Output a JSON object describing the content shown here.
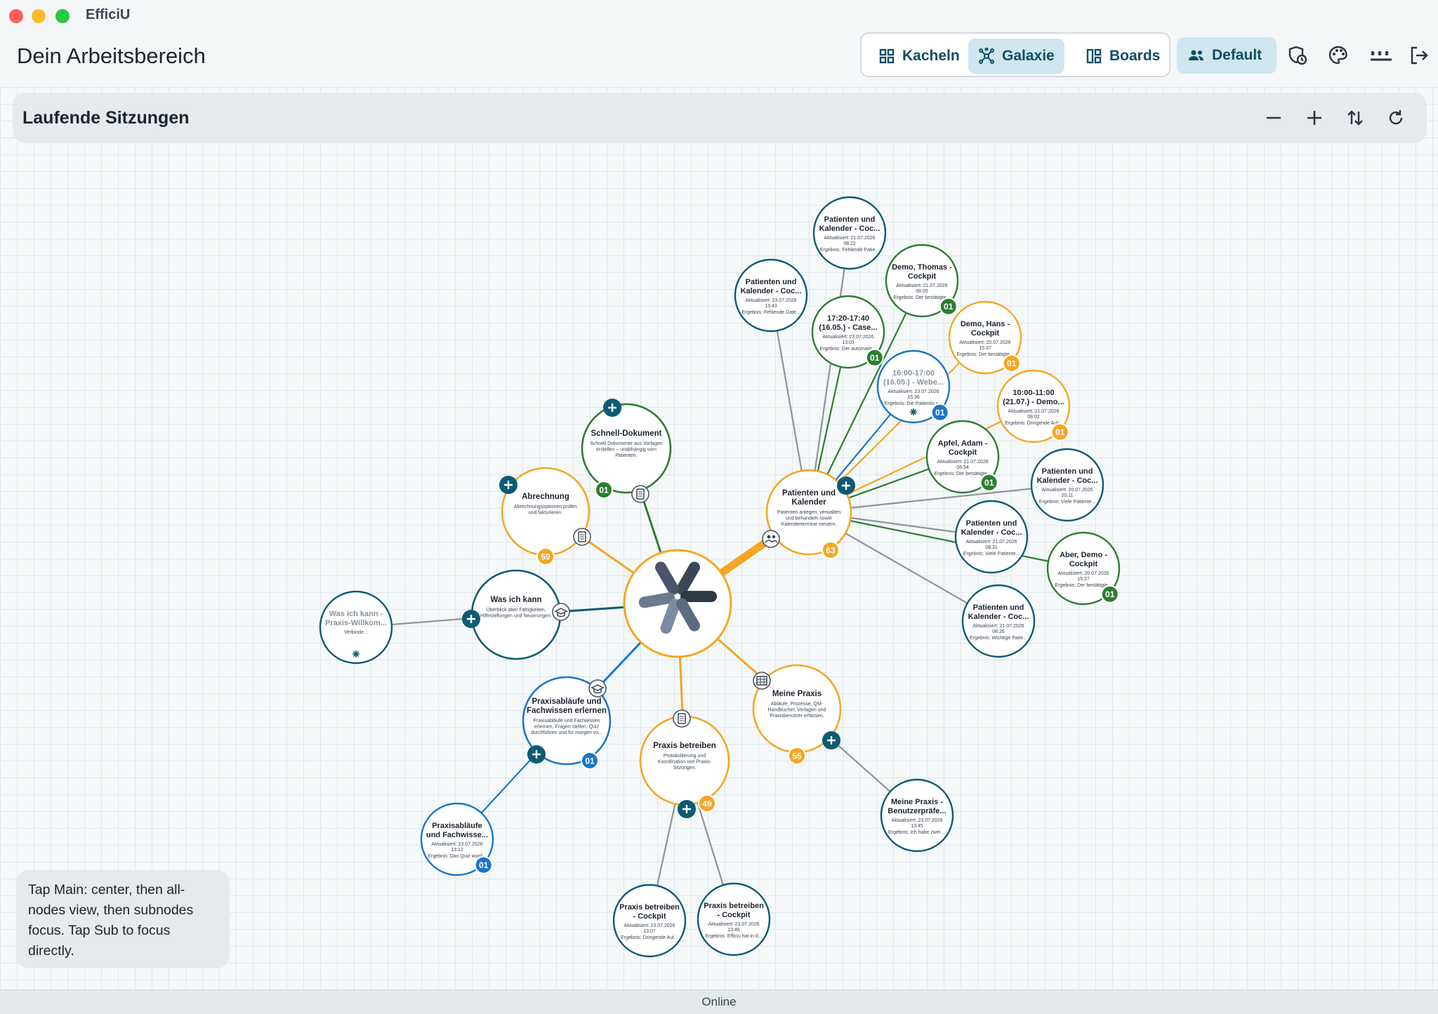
{
  "window": {
    "app_name": "EfficiU",
    "traffic_light_colors": [
      "#ff5f57",
      "#febc2e",
      "#28c840"
    ]
  },
  "header": {
    "title": "Dein Arbeitsbereich",
    "view_switch": [
      {
        "label": "Kacheln",
        "icon": "grid-icon",
        "active": false
      },
      {
        "label": "Galaxie",
        "icon": "galaxy-icon",
        "active": true
      },
      {
        "label": "Boards",
        "icon": "boards-icon",
        "active": false
      }
    ],
    "profile_label": "Default",
    "icons": [
      "shield-clock-icon",
      "palette-icon",
      "password-icon",
      "logout-icon"
    ]
  },
  "session_bar": {
    "title": "Laufende Sitzungen",
    "icons": [
      "zoom-out-icon",
      "zoom-in-icon",
      "sort-icon",
      "refresh-icon"
    ]
  },
  "colors": {
    "orange": "#f5a623",
    "green": "#2e7d32",
    "teal": "#0d5b73",
    "blue": "#1976c8",
    "gray_edge": "#8e9499"
  },
  "graph": {
    "main": {
      "name": "EfficiU",
      "icon": "efficiu-logo"
    },
    "categories": [
      {
        "id": "patienten",
        "title": "Patienten und Kalender",
        "desc": [
          "Patienten anlegen, verwalten",
          "und behandeln sowie",
          "Kalendertermine steuern."
        ],
        "count": "63",
        "color": "orange",
        "icon": "users-icon"
      },
      {
        "id": "abrechnung",
        "title": "Abrechnung",
        "desc": [
          "Abrechnungsoptionen prüfen",
          "und fakturieren."
        ],
        "count": "59",
        "color": "orange",
        "icon": "invoice-icon"
      },
      {
        "id": "schnell",
        "title": "Schnell-Dokument",
        "desc": [
          "Schnell Dokumente aus Vorlagen",
          "erstellen – unabhängig vom",
          "Patienten."
        ],
        "count": "01",
        "color": "green",
        "icon": "document-icon"
      },
      {
        "id": "wasichkann",
        "title": "Was ich kann",
        "desc": [
          "Überblick über Fähigkeiten,",
          "Hilfestellungen und Neuerungen."
        ],
        "count": "",
        "color": "teal",
        "icon": "graduation-cap-icon"
      },
      {
        "id": "praxisablaeufe",
        "title": "Praxisabläufe und Fachwissen erlernen",
        "desc": [
          "Praxisabläufe und Fachwissen",
          "erlernen, Fragen stellen, Quiz",
          "durchführen und für morgen vo..."
        ],
        "count": "01",
        "color": "blue",
        "icon": "graduation-cap-icon"
      },
      {
        "id": "praxisbetreiben",
        "title": "Praxis betreiben",
        "desc": [
          "Protokollierung und",
          "Koordination von Praxis-",
          "Sitzungen."
        ],
        "count": "49",
        "color": "orange",
        "icon": "clipboard-icon"
      },
      {
        "id": "meinepraxis",
        "title": "Meine Praxis",
        "desc": [
          "Abläufe, Prozesse, QM-",
          "Handbücher, Vorlagen und",
          "Praxisbenutzer erfassen."
        ],
        "count": "55",
        "color": "orange",
        "icon": "table-icon"
      }
    ],
    "sessions": [
      {
        "parent": "patienten",
        "title": [
          "Patienten und",
          "Kalender - Coc..."
        ],
        "updated": "Aktualisiert: 21.07.2026",
        "time": "08:22",
        "result": "Ergebnis: Fehlende Patie...",
        "color": "teal",
        "badge": ""
      },
      {
        "parent": "patienten",
        "title": [
          "Patienten und",
          "Kalender - Coc..."
        ],
        "updated": "Aktualisiert: 23.07.2026",
        "time": "13:43",
        "result": "Ergebnis: Fehlende Date...",
        "color": "teal",
        "badge": ""
      },
      {
        "parent": "patienten",
        "title": [
          "Demo, Thomas -",
          "Cockpit"
        ],
        "updated": "Aktualisiert: 21.07.2026",
        "time": "08:05",
        "result": "Ergebnis: Der bestätigte...",
        "color": "green",
        "badge": "01"
      },
      {
        "parent": "patienten",
        "title": [
          "17:20-17:40",
          "(16.05.) - Case..."
        ],
        "updated": "Aktualisiert: 23.07.2026",
        "time": "13:03",
        "result": "Ergebnis: Der automatis...",
        "color": "green",
        "badge": "01"
      },
      {
        "parent": "patienten",
        "title": [
          "Demo, Hans -",
          "Cockpit"
        ],
        "updated": "Aktualisiert: 20.07.2026",
        "time": "15:37",
        "result": "Ergebnis: Der bestätigte...",
        "color": "orange",
        "badge": "01"
      },
      {
        "parent": "patienten",
        "title": [
          "16:00-17:00",
          "(16.05.) - Webe..."
        ],
        "updated": "Aktualisiert: 23.07.2026",
        "time": "15:36",
        "result": "Ergebnis: Die Patientin s...",
        "color": "blue",
        "badge": "01",
        "faded": true
      },
      {
        "parent": "patienten",
        "title": [
          "10:00-11:00",
          "(21.07.) - Demo..."
        ],
        "updated": "Aktualisiert: 21.07.2026",
        "time": "08:02",
        "result": "Ergebnis: Dringende Auf...",
        "color": "orange",
        "badge": "01"
      },
      {
        "parent": "patienten",
        "title": [
          "Apfel, Adam -",
          "Cockpit"
        ],
        "updated": "Aktualisiert: 21.07.2026",
        "time": "08:54",
        "result": "Ergebnis: Der bestätigte...",
        "color": "green",
        "badge": "01"
      },
      {
        "parent": "patienten",
        "title": [
          "Patienten und",
          "Kalender - Coc..."
        ],
        "updated": "Aktualisiert: 20.07.2026",
        "time": "20:11",
        "result": "Ergebnis: Viele Patiente...",
        "color": "teal",
        "badge": ""
      },
      {
        "parent": "patienten",
        "title": [
          "Patienten und",
          "Kalender - Coc..."
        ],
        "updated": "Aktualisiert: 21.07.2026",
        "time": "08:31",
        "result": "Ergebnis: Viele Patiente...",
        "color": "teal",
        "badge": ""
      },
      {
        "parent": "patienten",
        "title": [
          "Aber, Demo -",
          "Cockpit"
        ],
        "updated": "Aktualisiert: 20.07.2026",
        "time": "15:27",
        "result": "Ergebnis: Der bestätigte...",
        "color": "green",
        "badge": "01"
      },
      {
        "parent": "patienten",
        "title": [
          "Patienten und",
          "Kalender - Coc..."
        ],
        "updated": "Aktualisiert: 21.07.2026",
        "time": "08:26",
        "result": "Ergebnis: Wichtige Patie...",
        "color": "teal",
        "badge": ""
      },
      {
        "parent": "wasichkann",
        "title": [
          "Was ich kann -",
          "Praxis-Willkom..."
        ],
        "updated": "Verbinde...",
        "time": "",
        "result": "",
        "color": "teal",
        "badge": "",
        "faded": true
      },
      {
        "parent": "praxisablaeufe",
        "title": [
          "Praxisabläufe",
          "und Fachwisse..."
        ],
        "updated": "Aktualisiert: 23.07.2026",
        "time": "13:12",
        "result": "Ergebnis: Das Quiz wurd...",
        "color": "blue",
        "badge": "01"
      },
      {
        "parent": "praxisbetreiben",
        "title": [
          "Praxis betreiben",
          "- Cockpit"
        ],
        "updated": "Aktualisiert: 23.07.2026",
        "time": "13:07",
        "result": "Ergebnis: Dringende Auf...",
        "color": "teal",
        "badge": ""
      },
      {
        "parent": "praxisbetreiben",
        "title": [
          "Praxis betreiben",
          "- Cockpit"
        ],
        "updated": "Aktualisiert: 23.07.2026",
        "time": "13:46",
        "result": "Ergebnis: Efficiu hat in d...",
        "color": "teal",
        "badge": ""
      },
      {
        "parent": "meinepraxis",
        "title": [
          "Meine Praxis -",
          "Benutzerpräfe..."
        ],
        "updated": "Aktualisiert: 23.07.2026",
        "time": "13:45",
        "result": "Ergebnis: Ich habe zwei ...",
        "color": "teal",
        "badge": ""
      }
    ]
  },
  "hint": "Tap Main: center, then all-nodes view, then subnodes focus. Tap Sub to focus directly.",
  "status": "Online"
}
